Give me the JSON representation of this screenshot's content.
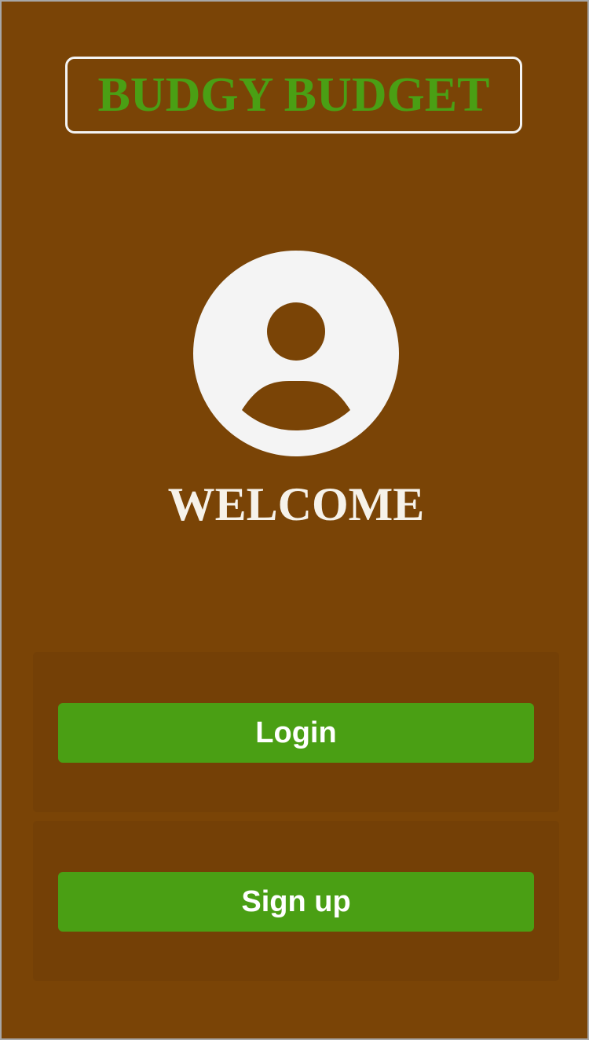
{
  "app": {
    "title": "BUDGY BUDGET"
  },
  "welcome": {
    "text": "WELCOME",
    "avatar_icon": "user-profile-icon"
  },
  "actions": {
    "login_label": "Login",
    "signup_label": "Sign up"
  },
  "colors": {
    "background": "#7a4406",
    "panel": "#744006",
    "accent_green": "#4a9f14",
    "text_light": "#f6f2ea",
    "avatar_fill": "#f4f4f4"
  }
}
